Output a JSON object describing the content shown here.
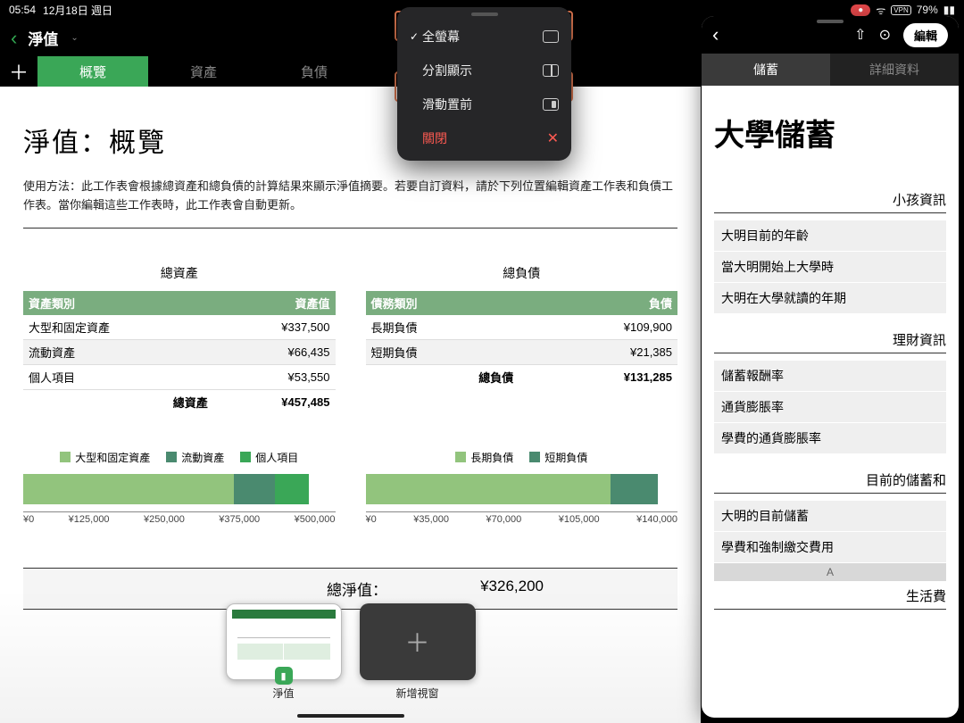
{
  "status": {
    "time": "05:54",
    "date": "12月18日 週日",
    "battery": "79%",
    "vpn": "VPN"
  },
  "app": {
    "title": "淨值",
    "tabs": [
      "概覽",
      "資產",
      "負債"
    ],
    "heading": "淨值：概覽",
    "desc": "使用方法：此工作表會根據總資產和總負債的計算結果來顯示淨值摘要。若要自訂資料，請於下列位置編輯資產工作表和負債工作表。當你編輯這些工作表時，此工作表會自動更新。",
    "assets": {
      "title": "總資產",
      "head": [
        "資產類別",
        "資產值"
      ],
      "rows": [
        {
          "label": "大型和固定資產",
          "value": "¥337,500"
        },
        {
          "label": "流動資產",
          "value": "¥66,435"
        },
        {
          "label": "個人項目",
          "value": "¥53,550"
        }
      ],
      "total_label": "總資產",
      "total_value": "¥457,485"
    },
    "liab": {
      "title": "總負債",
      "head": [
        "債務類別",
        "負債"
      ],
      "rows": [
        {
          "label": "長期負債",
          "value": "¥109,900"
        },
        {
          "label": "短期負債",
          "value": "¥21,385"
        }
      ],
      "total_label": "總負債",
      "total_value": "¥131,285"
    },
    "chart_left": {
      "legend": [
        "大型和固定資產",
        "流動資產",
        "個人項目"
      ],
      "ticks": [
        "¥0",
        "¥125,000",
        "¥250,000",
        "¥375,000",
        "¥500,000"
      ]
    },
    "chart_right": {
      "legend": [
        "長期負債",
        "短期負債"
      ],
      "ticks": [
        "¥0",
        "¥35,000",
        "¥70,000",
        "¥105,000",
        "¥140,000"
      ]
    },
    "net_label": "總淨值：",
    "net_value": "¥326,200",
    "switcher": {
      "current": "淨值",
      "new": "新增視窗"
    }
  },
  "chart_data": [
    {
      "type": "bar",
      "orientation": "horizontal-stacked",
      "title": "總資產",
      "series": [
        {
          "name": "大型和固定資產",
          "values": [
            337500
          ]
        },
        {
          "name": "流動資產",
          "values": [
            66435
          ]
        },
        {
          "name": "個人項目",
          "values": [
            53550
          ]
        }
      ],
      "xlim": [
        0,
        500000
      ],
      "xticks": [
        0,
        125000,
        250000,
        375000,
        500000
      ],
      "xlabel": "",
      "ylabel": ""
    },
    {
      "type": "bar",
      "orientation": "horizontal-stacked",
      "title": "總負債",
      "series": [
        {
          "name": "長期負債",
          "values": [
            109900
          ]
        },
        {
          "name": "短期負債",
          "values": [
            21385
          ]
        }
      ],
      "xlim": [
        0,
        140000
      ],
      "xticks": [
        0,
        35000,
        70000,
        105000,
        140000
      ],
      "xlabel": "",
      "ylabel": ""
    }
  ],
  "popover": {
    "fullscreen": "全螢幕",
    "split": "分割顯示",
    "slide": "滑動置前",
    "close": "關閉"
  },
  "side": {
    "edit": "編輯",
    "tabs": [
      "儲蓄",
      "詳細資料"
    ],
    "heading": "大學儲蓄",
    "sec1": "小孩資訊",
    "rows1": [
      "大明目前的年齡",
      "當大明開始上大學時",
      "大明在大學就讀的年期"
    ],
    "sec2": "理財資訊",
    "rows2": [
      "儲蓄報酬率",
      "通貨膨脹率",
      "學費的通貨膨脹率"
    ],
    "sec3": "目前的儲蓄和",
    "rows3": [
      "大明的目前儲蓄",
      "學費和強制繳交費用"
    ],
    "col_letter": "A",
    "sec4": "生活費"
  }
}
